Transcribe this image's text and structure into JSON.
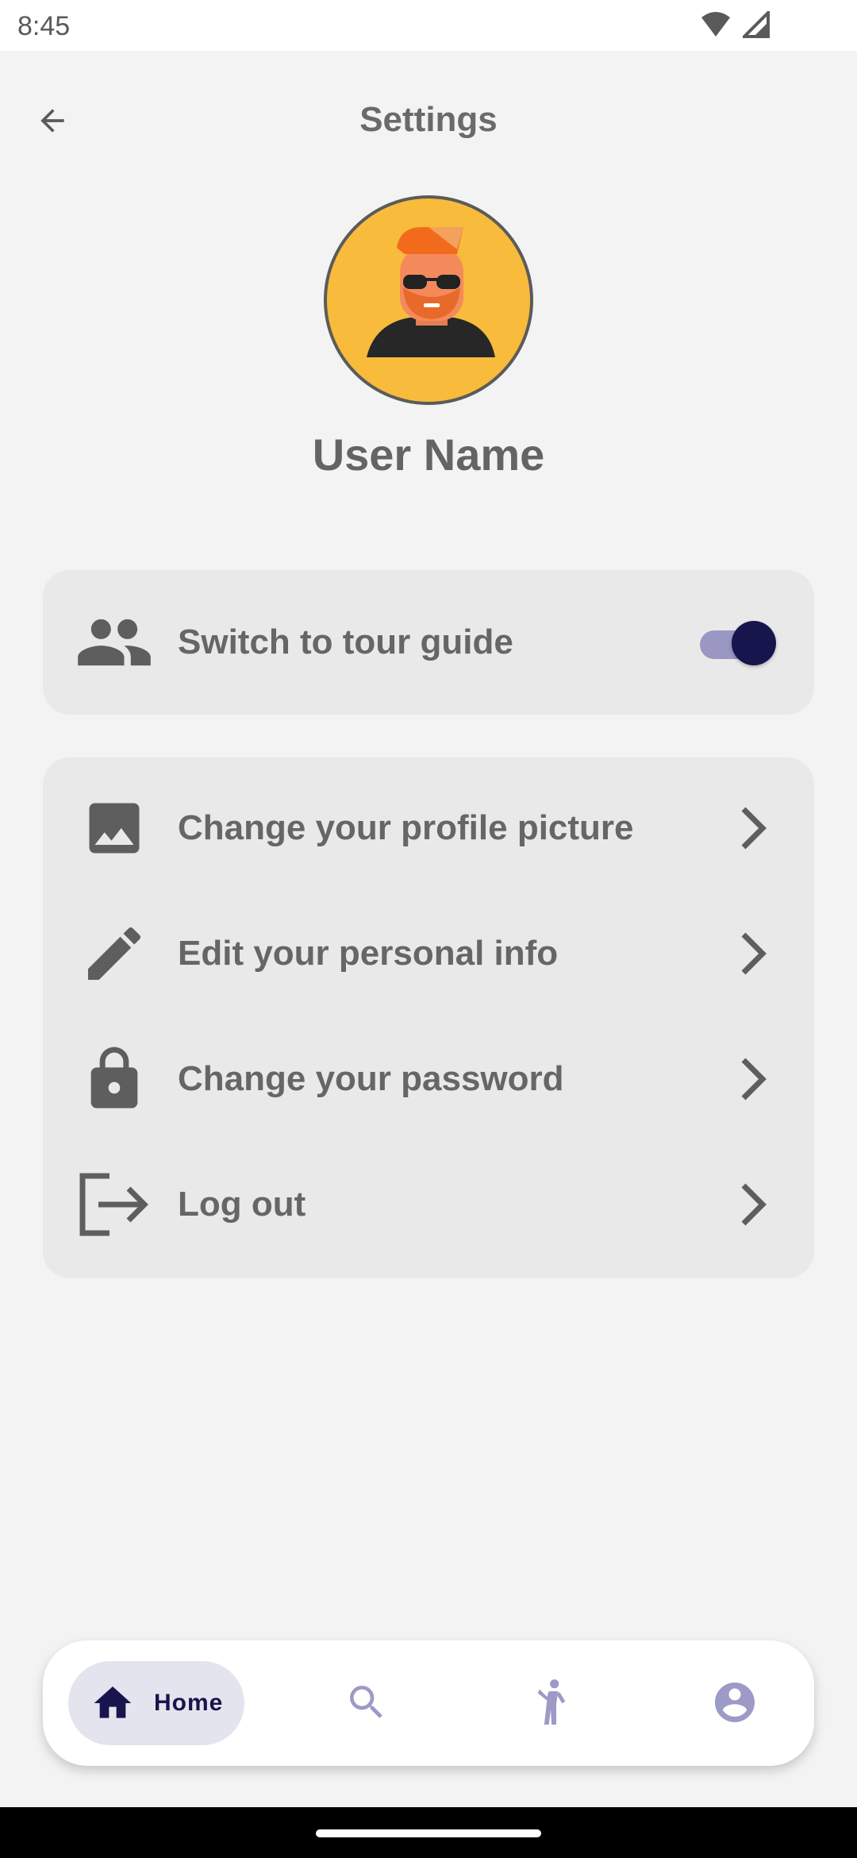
{
  "status_bar": {
    "time": "8:45",
    "icons": [
      "wifi-icon",
      "cell-signal-icon"
    ]
  },
  "header": {
    "title": "Settings",
    "back_icon": "arrow-back-icon"
  },
  "profile": {
    "avatar_icon": "avatar-man-sunglasses",
    "name": "User Name"
  },
  "toggle_card": {
    "icon": "people-icon",
    "label": "Switch to tour guide",
    "toggle_on": true
  },
  "menu": {
    "items": [
      {
        "icon": "image-icon",
        "label": "Change your profile picture"
      },
      {
        "icon": "pencil-icon",
        "label": "Edit your personal info"
      },
      {
        "icon": "lock-icon",
        "label": "Change your password"
      },
      {
        "icon": "logout-icon",
        "label": "Log out"
      }
    ]
  },
  "bottom_nav": {
    "home_label": "Home",
    "items": [
      "home-icon",
      "search-icon",
      "person-walking-icon",
      "account-circle-icon"
    ],
    "active": "Home"
  },
  "colors": {
    "background": "#f3f3f3",
    "card": "#e9e9e9",
    "accent": "#17154d",
    "toggle_track": "#9a97c2",
    "text": "#646464",
    "avatar_bg": "#f8bb3b"
  }
}
